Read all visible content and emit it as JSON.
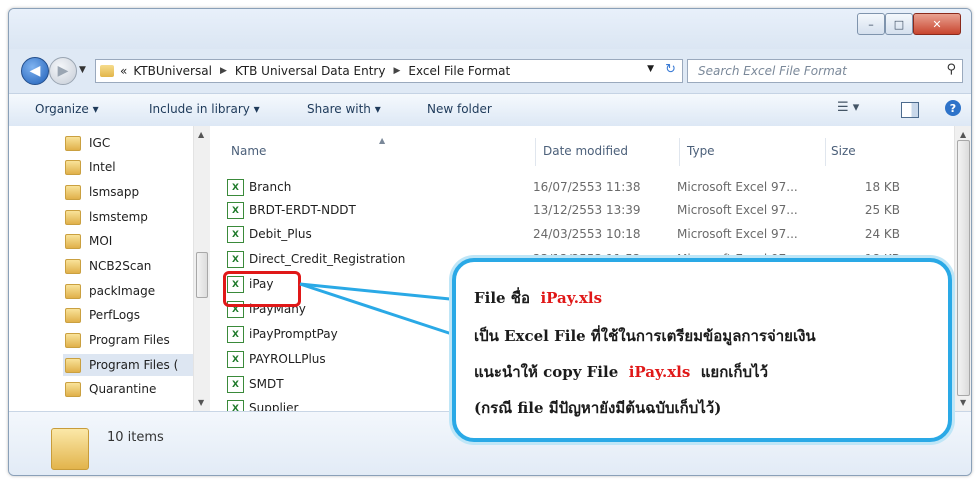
{
  "window": {
    "controls": {
      "minimize": "–",
      "maximize": "□",
      "close": "✕"
    }
  },
  "address": {
    "overflow": "«",
    "crumbs": [
      "KTBUniversal",
      "KTB Universal Data Entry",
      "Excel File Format"
    ],
    "search_placeholder": "Search Excel File Format"
  },
  "toolbar": {
    "organize": "Organize ▾",
    "include_in_library": "Include in library ▾",
    "share_with": "Share with ▾",
    "new_folder": "New folder"
  },
  "nav_pane": {
    "items": [
      "IGC",
      "Intel",
      "lsmsapp",
      "lsmstemp",
      "MOI",
      "NCB2Scan",
      "packImage",
      "PerfLogs",
      "Program Files",
      "Program Files (",
      "Quarantine"
    ],
    "selected_index": 9
  },
  "columns": {
    "name": "Name",
    "date": "Date modified",
    "type": "Type",
    "size": "Size"
  },
  "files": [
    {
      "name": "Branch",
      "date": "16/07/2553 11:38",
      "type": "Microsoft Excel 97...",
      "size": "18 KB"
    },
    {
      "name": "BRDT-ERDT-NDDT",
      "date": "13/12/2553 13:39",
      "type": "Microsoft Excel 97...",
      "size": "25 KB"
    },
    {
      "name": "Debit_Plus",
      "date": "24/03/2553 10:18",
      "type": "Microsoft Excel 97...",
      "size": "24 KB"
    },
    {
      "name": "Direct_Credit_Registration",
      "date": "23/12/2553 11:52",
      "type": "Microsoft Excel 97...",
      "size": "18 KB"
    },
    {
      "name": "iPay",
      "date": "",
      "type": "",
      "size": ""
    },
    {
      "name": "iPayMany",
      "date": "",
      "type": "",
      "size": ""
    },
    {
      "name": "iPayPromptPay",
      "date": "",
      "type": "",
      "size": ""
    },
    {
      "name": "PAYROLLPlus",
      "date": "",
      "type": "",
      "size": ""
    },
    {
      "name": "SMDT",
      "date": "",
      "type": "",
      "size": ""
    },
    {
      "name": "Supplier",
      "date": "",
      "type": "",
      "size": ""
    }
  ],
  "status": {
    "item_count": "10 items"
  },
  "callout": {
    "line1_prefix": "File ชื่อ",
    "line1_file": "iPay.xls",
    "line2": "เป็น Excel File ที่ใช้ในการเตรียมข้อมูลการจ่ายเงิน",
    "line3_prefix": "แนะนำให้ copy File",
    "line3_file": "iPay.xls",
    "line3_suffix": "แยกเก็บไว้",
    "line4": "(กรณี file มีปัญหายังมีต้นฉบับเก็บไว้)"
  },
  "colors": {
    "accent": "#2aa9e6",
    "highlight": "#e01818"
  }
}
